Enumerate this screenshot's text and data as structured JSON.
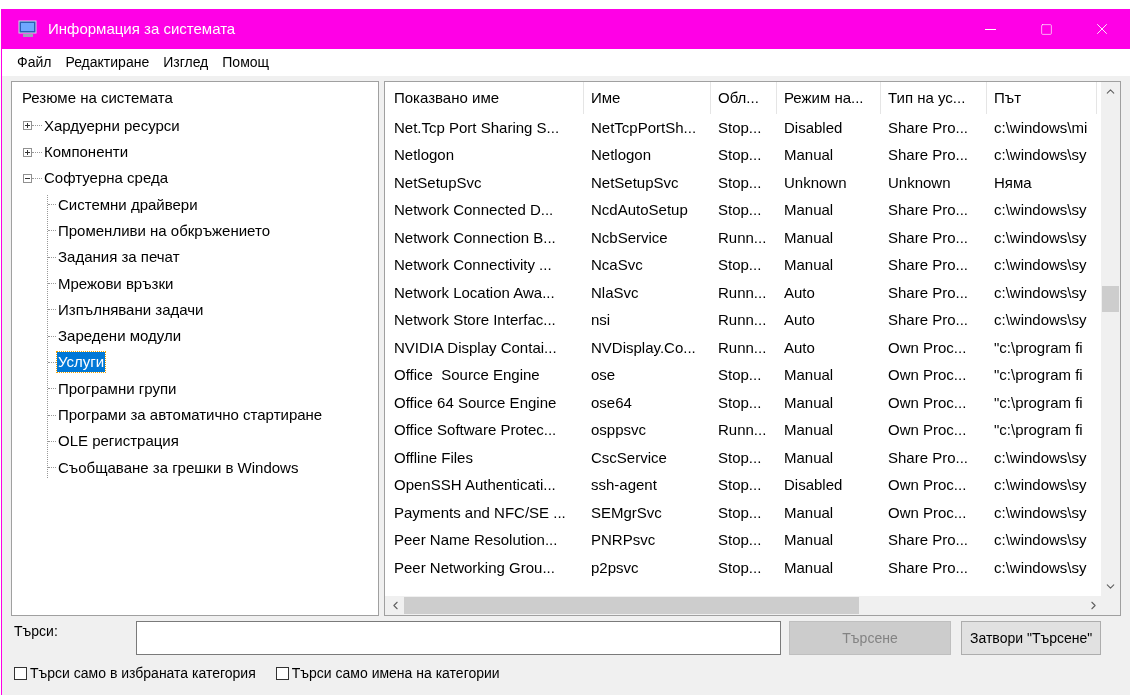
{
  "window": {
    "title": "Информация за системата"
  },
  "menu": [
    "Файл",
    "Редактиране",
    "Изглед",
    "Помощ"
  ],
  "tree": {
    "label": "Резюме на системата",
    "selected": false,
    "children": [
      {
        "label": "Хардуерни ресурси",
        "expanded": false,
        "selected": false
      },
      {
        "label": "Компоненти",
        "expanded": false,
        "selected": false
      },
      {
        "label": "Софтуерна среда",
        "expanded": true,
        "selected": false,
        "children": [
          {
            "label": "Системни драйвери",
            "selected": false
          },
          {
            "label": "Променливи на обкръжението",
            "selected": false
          },
          {
            "label": "Задания за печат",
            "selected": false
          },
          {
            "label": "Мрежови връзки",
            "selected": false
          },
          {
            "label": "Изпълнявани задачи",
            "selected": false
          },
          {
            "label": "Заредени модули",
            "selected": false
          },
          {
            "label": "Услуги",
            "selected": true
          },
          {
            "label": "Програмни групи",
            "selected": false
          },
          {
            "label": "Програми за автоматично стартиране",
            "selected": false
          },
          {
            "label": "OLE регистрация",
            "selected": false
          },
          {
            "label": "Съобщаване за грешки в Windows",
            "selected": false
          }
        ]
      }
    ]
  },
  "table": {
    "columns": [
      "Показвано име",
      "Име",
      "Обл...",
      "Режим на...",
      "Тип на ус...",
      "Път"
    ],
    "rows": [
      [
        "Net.Tcp Port Sharing S...",
        "NetTcpPortSh...",
        "Stop...",
        "Disabled",
        "Share Pro...",
        "c:\\windows\\mi"
      ],
      [
        "Netlogon",
        "Netlogon",
        "Stop...",
        "Manual",
        "Share Pro...",
        "c:\\windows\\sy"
      ],
      [
        "NetSetupSvc",
        "NetSetupSvc",
        "Stop...",
        "Unknown",
        "Unknown",
        "Няма"
      ],
      [
        "Network Connected D...",
        "NcdAutoSetup",
        "Stop...",
        "Manual",
        "Share Pro...",
        "c:\\windows\\sy"
      ],
      [
        "Network Connection B...",
        "NcbService",
        "Runn...",
        "Manual",
        "Share Pro...",
        "c:\\windows\\sy"
      ],
      [
        "Network Connectivity ...",
        "NcaSvc",
        "Stop...",
        "Manual",
        "Share Pro...",
        "c:\\windows\\sy"
      ],
      [
        "Network Location Awa...",
        "NlaSvc",
        "Runn...",
        "Auto",
        "Share Pro...",
        "c:\\windows\\sy"
      ],
      [
        "Network Store Interfac...",
        "nsi",
        "Runn...",
        "Auto",
        "Share Pro...",
        "c:\\windows\\sy"
      ],
      [
        "NVIDIA Display Contai...",
        "NVDisplay.Co...",
        "Runn...",
        "Auto",
        "Own Proc...",
        "\"c:\\program fi"
      ],
      [
        "Office  Source Engine",
        "ose",
        "Stop...",
        "Manual",
        "Own Proc...",
        "\"c:\\program fi"
      ],
      [
        "Office 64 Source Engine",
        "ose64",
        "Stop...",
        "Manual",
        "Own Proc...",
        "\"c:\\program fi"
      ],
      [
        "Office Software Protec...",
        "osppsvc",
        "Runn...",
        "Manual",
        "Own Proc...",
        "\"c:\\program fi"
      ],
      [
        "Offline Files",
        "CscService",
        "Stop...",
        "Manual",
        "Share Pro...",
        "c:\\windows\\sy"
      ],
      [
        "OpenSSH Authenticati...",
        "ssh-agent",
        "Stop...",
        "Disabled",
        "Own Proc...",
        "c:\\windows\\sy"
      ],
      [
        "Payments and NFC/SE ...",
        "SEMgrSvc",
        "Stop...",
        "Manual",
        "Own Proc...",
        "c:\\windows\\sy"
      ],
      [
        "Peer Name Resolution...",
        "PNRPsvc",
        "Stop...",
        "Manual",
        "Share Pro...",
        "c:\\windows\\sy"
      ],
      [
        "Peer Networking Grou...",
        "p2psvc",
        "Stop...",
        "Manual",
        "Share Pro...",
        "c:\\windows\\sy"
      ]
    ]
  },
  "search": {
    "label": "Търси:",
    "buttons": [
      {
        "label": "Търсене",
        "disabled": true
      },
      {
        "label": "Затвори \"Търсене\"",
        "disabled": false
      }
    ],
    "checkboxes": [
      {
        "label": "Търси само в избраната категория",
        "checked": false
      },
      {
        "label": "Търси само имена на категории",
        "checked": false
      }
    ]
  }
}
